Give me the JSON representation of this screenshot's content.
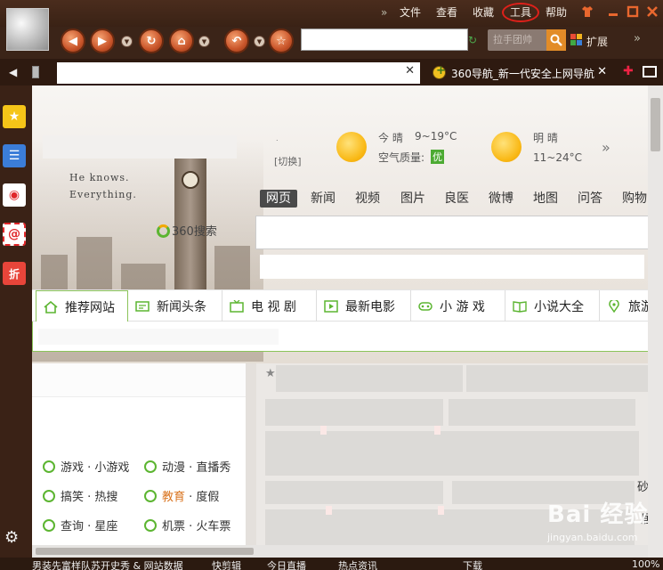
{
  "menubar": {
    "items": [
      "文件",
      "查看",
      "收藏",
      "工具",
      "帮助"
    ],
    "more_chevron": "»"
  },
  "toolbar": {
    "search_placeholder": "拉手团帅",
    "extensions_label": "扩展",
    "more": "»"
  },
  "tabs": [
    {
      "title": "",
      "close": "✕"
    },
    {
      "title": "360导航_新一代安全上网导航",
      "close": "✕"
    }
  ],
  "header": {
    "slogan_line1": "He knows.",
    "slogan_line2": "Everything.",
    "dot": ".",
    "switch_label": "[切换]"
  },
  "weather": {
    "today_label": "今 晴",
    "today_temp": "9~19°C",
    "air_label": "空气质量:",
    "air_value": "优",
    "tomorrow_label": "明 晴",
    "tomorrow_temp": "11~24°C",
    "more": "»"
  },
  "search": {
    "tabs": [
      "网页",
      "新闻",
      "视频",
      "图片",
      "良医",
      "微博",
      "地图",
      "问答",
      "购物"
    ],
    "engine_label": "360搜索"
  },
  "categories": [
    "推荐网站",
    "新闻头条",
    "电 视 剧",
    "最新电影",
    "小 游 戏",
    "小说大全",
    "旅游"
  ],
  "links": [
    {
      "a": "游戏",
      "b": "小游戏"
    },
    {
      "a": "动漫",
      "b": "直播秀"
    },
    {
      "a": "搞笑",
      "b": "热搜"
    },
    {
      "a": "教育",
      "b": "度假"
    },
    {
      "a": "查询",
      "b": "星座"
    },
    {
      "a": "机票",
      "b": "火车票"
    }
  ],
  "right_edge": [
    "砂教",
    "居"
  ],
  "status": {
    "items": [
      "男装先富样队苏开史秀 & 网站数据",
      "快剪辑",
      "今日直播",
      "热点资讯",
      "下载",
      "100%"
    ]
  },
  "watermark": {
    "brand": "Bai 经验",
    "url": "jingyan.baidu.com"
  },
  "colors": {
    "chrome": "#3b2418",
    "accent_green": "#5cb531",
    "highlight_red": "#e0201a"
  }
}
